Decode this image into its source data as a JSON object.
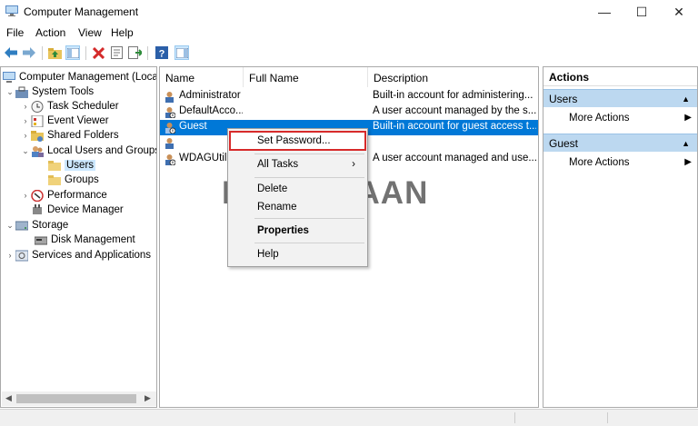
{
  "window": {
    "title": "Computer Management",
    "minimize": "—",
    "maximize": "☐",
    "close": "✕"
  },
  "menu": [
    "File",
    "Action",
    "View",
    "Help"
  ],
  "toolbar": {
    "icons": [
      "back-icon",
      "forward-icon",
      "up-folder-icon",
      "show-hide-tree-icon",
      "delete-icon",
      "properties-icon",
      "export-list-icon",
      "help-icon",
      "show-hide-action-pane-icon"
    ]
  },
  "tree": {
    "root": "Computer Management (Local",
    "system_tools": "System Tools",
    "task_scheduler": "Task Scheduler",
    "event_viewer": "Event Viewer",
    "shared_folders": "Shared Folders",
    "local_users_groups": "Local Users and Groups",
    "users": "Users",
    "groups": "Groups",
    "performance": "Performance",
    "device_manager": "Device Manager",
    "storage": "Storage",
    "disk_management": "Disk Management",
    "services_apps": "Services and Applications"
  },
  "list": {
    "columns": [
      "Name",
      "Full Name",
      "Description"
    ],
    "rows": [
      {
        "name": "Administrator",
        "full_name": "",
        "description": "Built-in account for administering..."
      },
      {
        "name": "DefaultAcco...",
        "full_name": "",
        "description": "A user account managed by the s..."
      },
      {
        "name": "Guest",
        "full_name": "",
        "description": "Built-in account for guest access t..."
      },
      {
        "name": "",
        "full_name": "",
        "description": ""
      },
      {
        "name": "WDAGUtilit",
        "full_name": "",
        "description": "A user account managed and use..."
      }
    ]
  },
  "actions": {
    "header": "Actions",
    "sections": [
      {
        "title": "Users",
        "item": "More Actions"
      },
      {
        "title": "Guest",
        "item": "More Actions"
      }
    ]
  },
  "context_menu": {
    "items": [
      "Set Password...",
      "All Tasks",
      "Delete",
      "Rename",
      "Properties",
      "Help"
    ],
    "highlighted": "Set Password..."
  },
  "watermark": {
    "before": "M",
    "after": "BIGYAAN"
  },
  "colors": {
    "selection": "#0078d7",
    "tree_selection": "#cce8ff",
    "action_section": "#bcd8f0",
    "highlight_border": "#d72a2a",
    "watermark_o": "#3a8fd9"
  }
}
